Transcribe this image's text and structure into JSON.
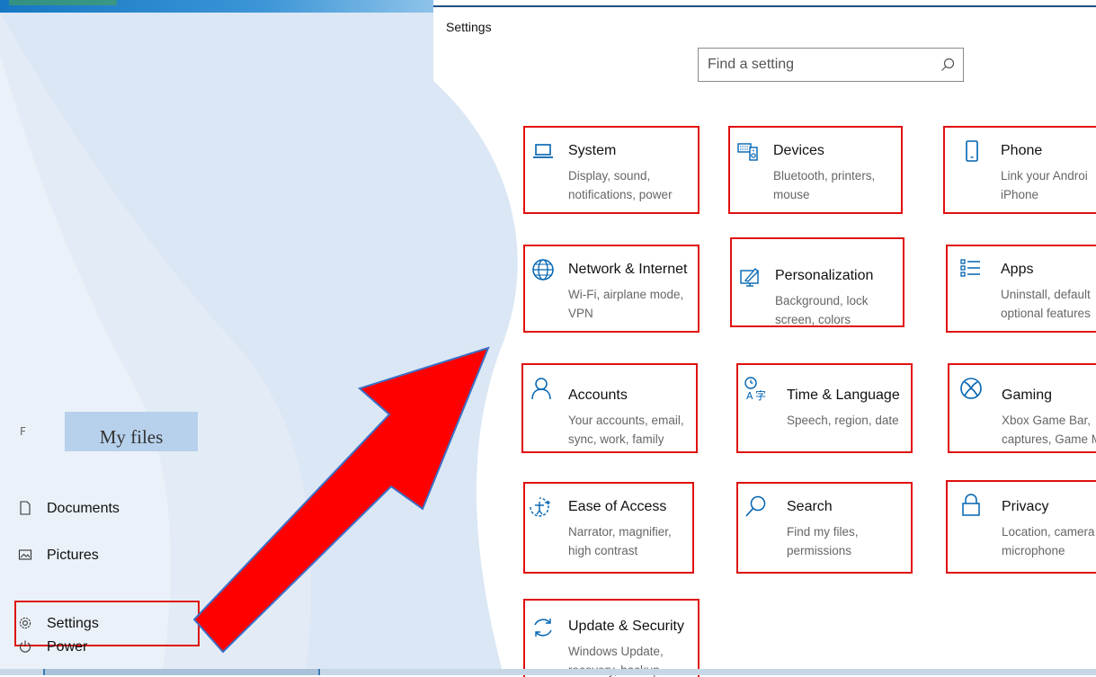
{
  "settings": {
    "window_title": "Settings",
    "search": {
      "placeholder": "Find a setting"
    },
    "categories": [
      {
        "title": "System",
        "desc1": "Display, sound,",
        "desc2": "notifications, power",
        "icon": "laptop-icon"
      },
      {
        "title": "Devices",
        "desc1": "Bluetooth, printers,",
        "desc2": "mouse",
        "icon": "keyboard-speaker-icon"
      },
      {
        "title": "Phone",
        "desc1": "Link your Androi",
        "desc2": "iPhone",
        "icon": "phone-icon"
      },
      {
        "title": "Network & Internet",
        "desc1": "Wi-Fi, airplane mode,",
        "desc2": "VPN",
        "icon": "globe-icon"
      },
      {
        "title": "Personalization",
        "desc1": "Background, lock",
        "desc2": "screen, colors",
        "icon": "paint-brush-icon"
      },
      {
        "title": "Apps",
        "desc1": "Uninstall, default",
        "desc2": "optional features",
        "icon": "apps-list-icon"
      },
      {
        "title": "Accounts",
        "desc1": "Your accounts, email,",
        "desc2": "sync, work, family",
        "icon": "person-icon"
      },
      {
        "title": "Time & Language",
        "desc1": "Speech, region, date",
        "desc2": "",
        "icon": "time-language-icon"
      },
      {
        "title": "Gaming",
        "desc1": "Xbox Game Bar,",
        "desc2": "captures, Game M",
        "icon": "xbox-icon"
      },
      {
        "title": "Ease of Access",
        "desc1": "Narrator, magnifier,",
        "desc2": "high contrast",
        "icon": "ease-of-access-icon"
      },
      {
        "title": "Search",
        "desc1": "Find my files,",
        "desc2": "permissions",
        "icon": "magnifier-icon"
      },
      {
        "title": "Privacy",
        "desc1": "Location, camera",
        "desc2": "microphone",
        "icon": "lock-icon"
      },
      {
        "title": "Update & Security",
        "desc1": "Windows Update,",
        "desc2": "recovery, backup",
        "icon": "refresh-icon"
      }
    ]
  },
  "start_menu": {
    "my_files_label": "My files",
    "items": [
      {
        "label": "Documents",
        "icon": "document-icon"
      },
      {
        "label": "Pictures",
        "icon": "picture-icon"
      },
      {
        "label": "Settings",
        "icon": "gear-icon"
      },
      {
        "label": "Power",
        "icon": "power-icon"
      }
    ]
  },
  "colors": {
    "highlight": "#e01010",
    "accent": "#0078d7",
    "arrow_fill": "#ff0000",
    "arrow_stroke": "#3a6fc4"
  }
}
